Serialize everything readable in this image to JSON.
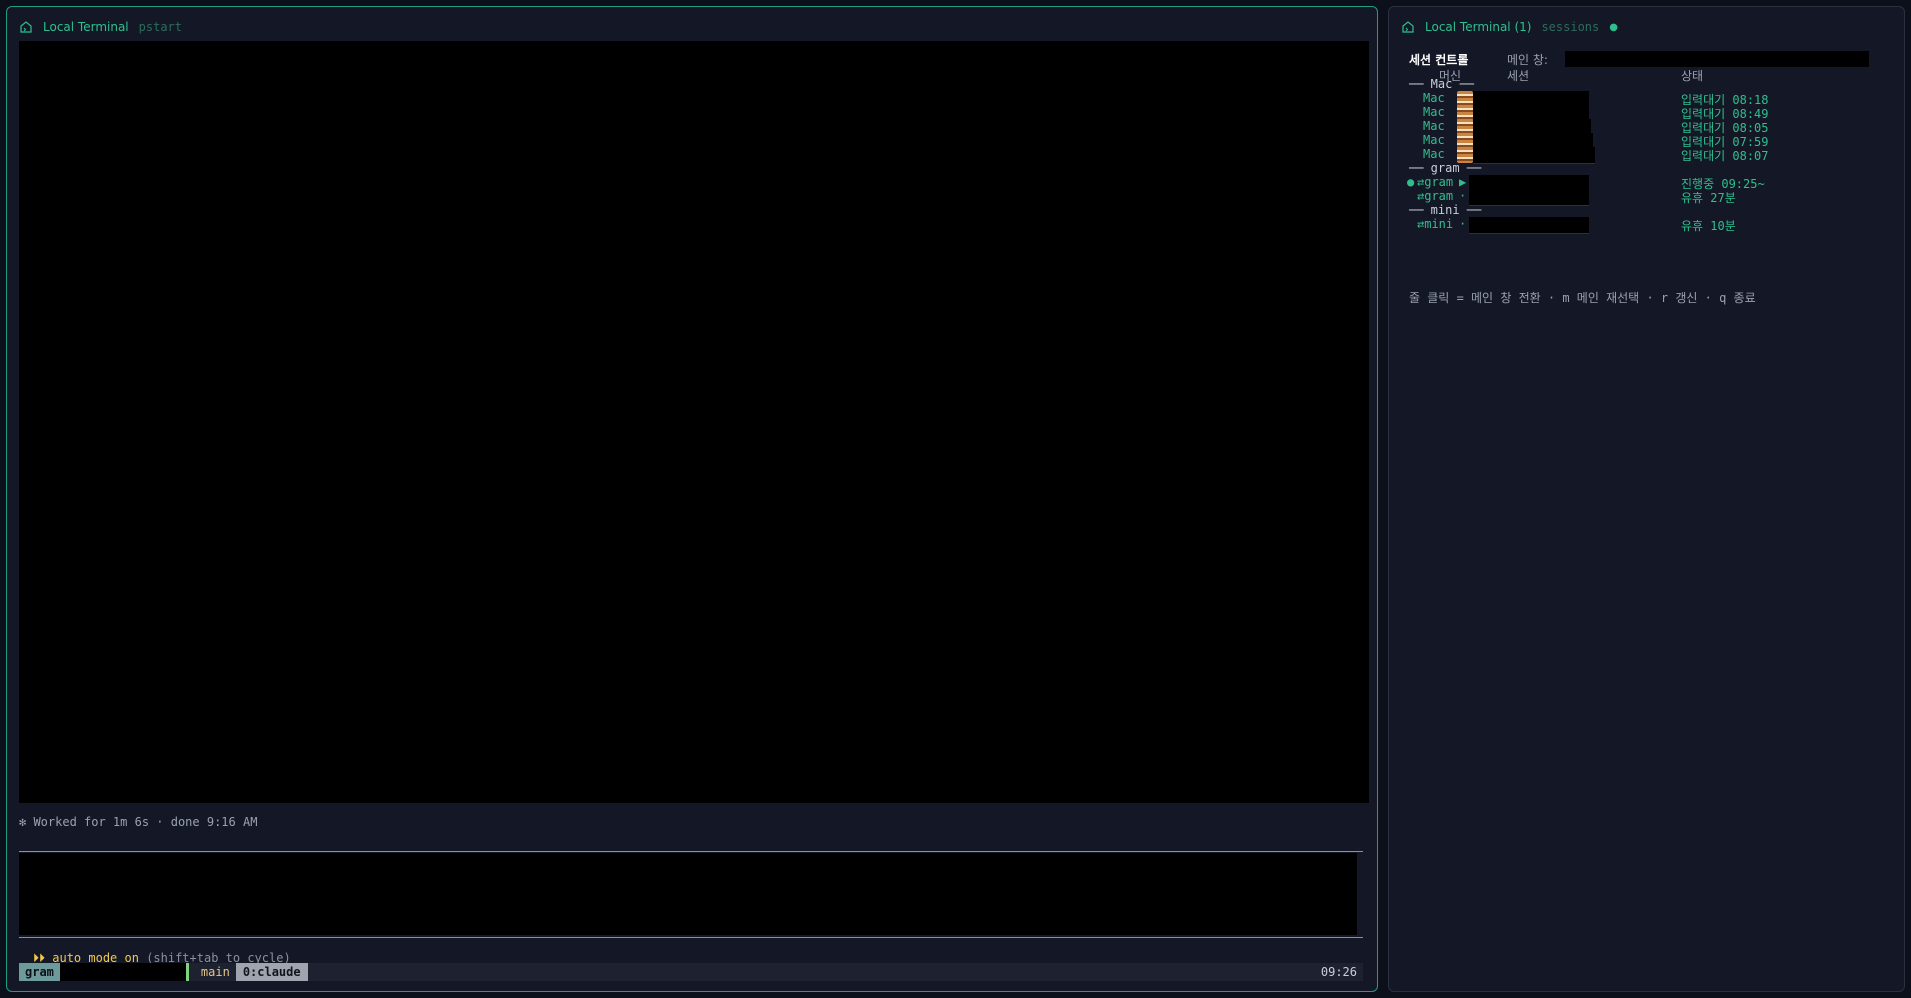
{
  "left_pane": {
    "title": "Local Terminal",
    "subtitle": "pstart",
    "worked_line": "✻ Worked for 1m 6s · done 9:16 AM",
    "auto_mode": {
      "arrows": "⏵⏵",
      "label": "auto mode on",
      "hint": "(shift+tab to cycle)"
    },
    "status_bar": {
      "session": "gram",
      "branch": "main",
      "window": "0:claude",
      "time": "09:26"
    }
  },
  "right_pane": {
    "title": "Local Terminal (1)",
    "subtitle": "sessions",
    "dot": "●",
    "control_title": "세션 컨트롤",
    "main_window_label": "메인 창:",
    "columns": {
      "machine": "머신",
      "session": "세션",
      "status": "상태"
    },
    "groups": [
      {
        "header": "── Mac ──",
        "rows": [
          {
            "marker": "",
            "machine": "Mac",
            "indicator": "thumbnail",
            "status": "입력대기 08:18"
          },
          {
            "marker": "",
            "machine": "Mac",
            "indicator": "thumbnail",
            "status": "입력대기 08:49"
          },
          {
            "marker": "",
            "machine": "Mac",
            "indicator": "thumbnail",
            "status": "입력대기 08:05"
          },
          {
            "marker": "",
            "machine": "Mac",
            "indicator": "thumbnail",
            "status": "입력대기 07:59"
          },
          {
            "marker": "",
            "machine": "Mac",
            "indicator": "thumbnail",
            "status": "입력대기 08:07"
          }
        ]
      },
      {
        "header": "── gram ──",
        "rows": [
          {
            "marker": "●",
            "machine": "⇄gram",
            "indicator": "▶",
            "status": "진행중 09:25~"
          },
          {
            "marker": "",
            "machine": "⇄gram",
            "indicator": "·",
            "status": "유휴 27분"
          }
        ]
      },
      {
        "header": "── mini ──",
        "rows": [
          {
            "marker": "",
            "machine": "⇄mini",
            "indicator": "·",
            "status": "유휴 10분"
          }
        ]
      }
    ],
    "hint_line": "줄 클릭 = 메인 창 전환 · m 메인 재선택 · r 갱신 · q 종료"
  },
  "colors": {
    "accent": "#2fbf8f",
    "background": "#141826",
    "terminal_black": "#000000",
    "auto_mode": "#f0c94a"
  },
  "icons": {
    "pane_icon": "terminal-house-icon",
    "play": "play-icon"
  }
}
